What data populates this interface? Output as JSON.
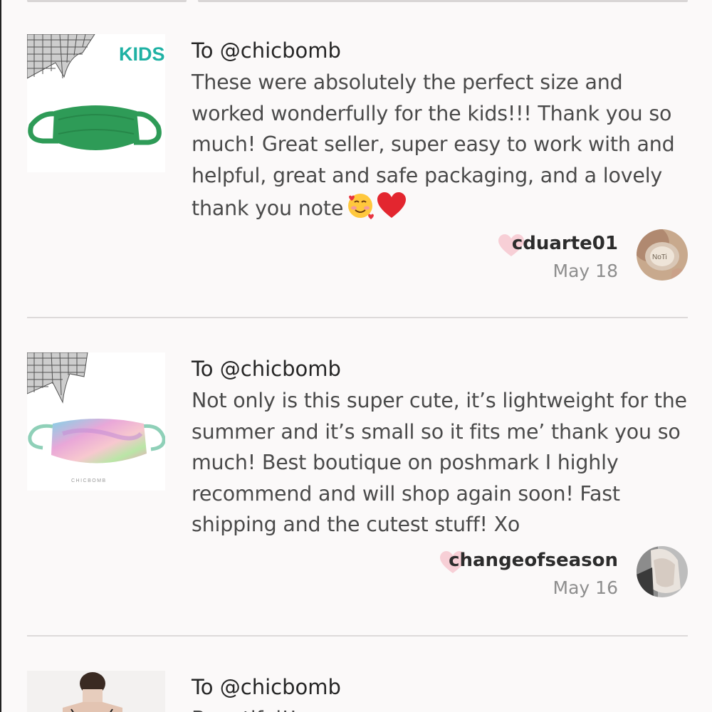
{
  "reviews": [
    {
      "thumb_label": "KIDS",
      "recipient": "To @chicbomb",
      "text": "These were absolutely the perfect size and worked wonderfully for the kids!!! Thank you so much! Great seller, super easy to work with and helpful, great and safe packaging, and a lovely thank you note",
      "emojis": [
        "smiling-face-with-hearts-icon",
        "red-heart-icon"
      ],
      "username": "cduarte01",
      "date": "May 18"
    },
    {
      "thumb_label": "CHICBOMB",
      "recipient": "To @chicbomb",
      "text": "Not only is this super cute, it’s lightweight for the summer and it’s small so it fits me’ thank you so much! Best boutique on poshmark I highly recommend and will shop again soon! Fast shipping and the cutest stuff! Xo",
      "username": "changeofseason",
      "date": "May 16"
    },
    {
      "recipient": "To @chicbomb",
      "text": "Beautiful!!"
    }
  ],
  "colors": {
    "background": "#fbf9f9",
    "heart": "#f7cfd6",
    "mask_green": "#2e9b57",
    "kids_teal": "#1fb1a4"
  }
}
